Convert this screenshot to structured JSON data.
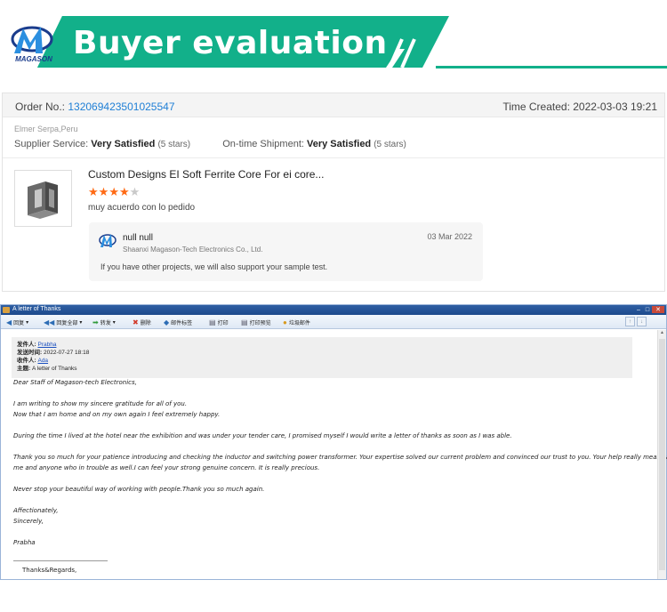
{
  "banner": {
    "title": "Buyer evaluation",
    "logo_text": "MAGASON",
    "color": "#12b08a"
  },
  "review": {
    "order_label": "Order No.:",
    "order_number": "132069423501025547",
    "time_created": "Time Created: 2022-03-03 19:21",
    "buyer": "Elmer Serpa,Peru",
    "supplier_service_label": "Supplier Service:",
    "supplier_service_value": "Very Satisfied",
    "supplier_service_stars": "(5 stars)",
    "shipment_label": "On-time Shipment:",
    "shipment_value": "Very Satisfied",
    "shipment_stars": "(5 stars)",
    "product_title": "Custom Designs EI Soft Ferrite Core For ei core...",
    "rating": 4,
    "rating_max": 5,
    "comment": "muy acuerdo con lo pedido",
    "reply": {
      "name": "null null",
      "company": "Shaanxi Magason-Tech Electronics Co., Ltd.",
      "date": "03 Mar 2022",
      "text": "If you have other projects, we will also support your sample test."
    }
  },
  "mail": {
    "window_title": "A letter of Thanks",
    "toolbar": [
      {
        "name": "reply",
        "label": "回复"
      },
      {
        "name": "reply-all",
        "label": "回复全部"
      },
      {
        "name": "forward",
        "label": "转发"
      },
      {
        "name": "delete",
        "label": "删除"
      },
      {
        "name": "mail-tag",
        "label": "邮件标签"
      },
      {
        "name": "print",
        "label": "打印"
      },
      {
        "name": "print-preview",
        "label": "打印预览"
      },
      {
        "name": "junk",
        "label": "垃圾邮件"
      }
    ],
    "header": {
      "from_label": "发件人:",
      "from": "Prabha",
      "sent_label": "发送时间:",
      "sent": "2022-07-27 18:18",
      "to_label": "收件人:",
      "to": "Ada",
      "subject_label": "主题:",
      "subject": "A letter of  Thanks"
    },
    "body": [
      "Dear Staff of Magason-tech Electronics,",
      "I am writing to show my sincere gratitude for all of you.",
      "Now that I am home and on my own again I feel extremely happy.",
      "During the time I lived at the hotel near the exhibition and was under your tender care, I promised myself I would write a letter of thanks as soon as I was able.",
      "Thank you so much for your patience introducing and checking the inductor and switching power transformer. Your expertise solved our current problem and convinced our trust to you. Your help really means a lot to",
      "me and anyone who in trouble as well.I can feel your strong genuine concern. It is really precious.",
      "Never stop your beautiful way of working with people.Thank you so much again.",
      "Affectionately,",
      "Sincerely,",
      "Prabha"
    ],
    "regards": "Thanks&Regards,"
  }
}
